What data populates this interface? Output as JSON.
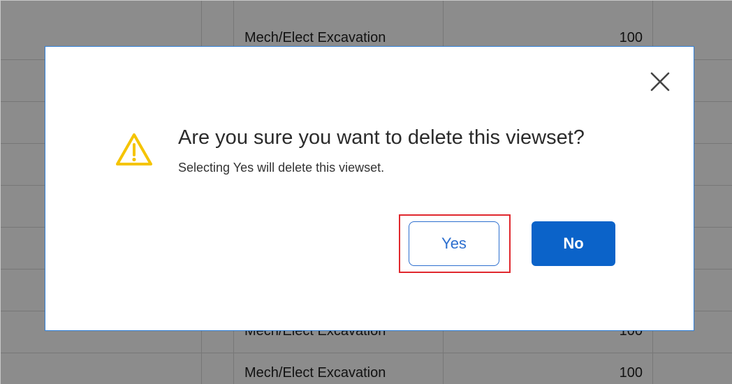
{
  "background_table": {
    "rows": [
      {
        "activity": "Mech/Elect Excavation",
        "value": "100"
      },
      {
        "activity": "",
        "value": ""
      },
      {
        "activity": "",
        "value": ""
      },
      {
        "activity": "",
        "value": ""
      },
      {
        "activity": "",
        "value": ""
      },
      {
        "activity": "",
        "value": ""
      },
      {
        "activity": "",
        "value": ""
      },
      {
        "activity": "Mech/Elect Excavation",
        "value": "100"
      },
      {
        "activity": "Mech/Elect Excavation",
        "value": "100"
      }
    ]
  },
  "dialog": {
    "title": "Are you sure you want to delete this viewset?",
    "message": "Selecting Yes will delete this viewset.",
    "yes_label": "Yes",
    "no_label": "No",
    "close_icon": "close-icon",
    "warning_icon": "warning-icon"
  },
  "colors": {
    "accent": "#0b63c9",
    "outline_button": "#2d6fcf",
    "dialog_border": "#2f80d9",
    "warning": "#f5c400",
    "highlight": "#e0282e"
  }
}
